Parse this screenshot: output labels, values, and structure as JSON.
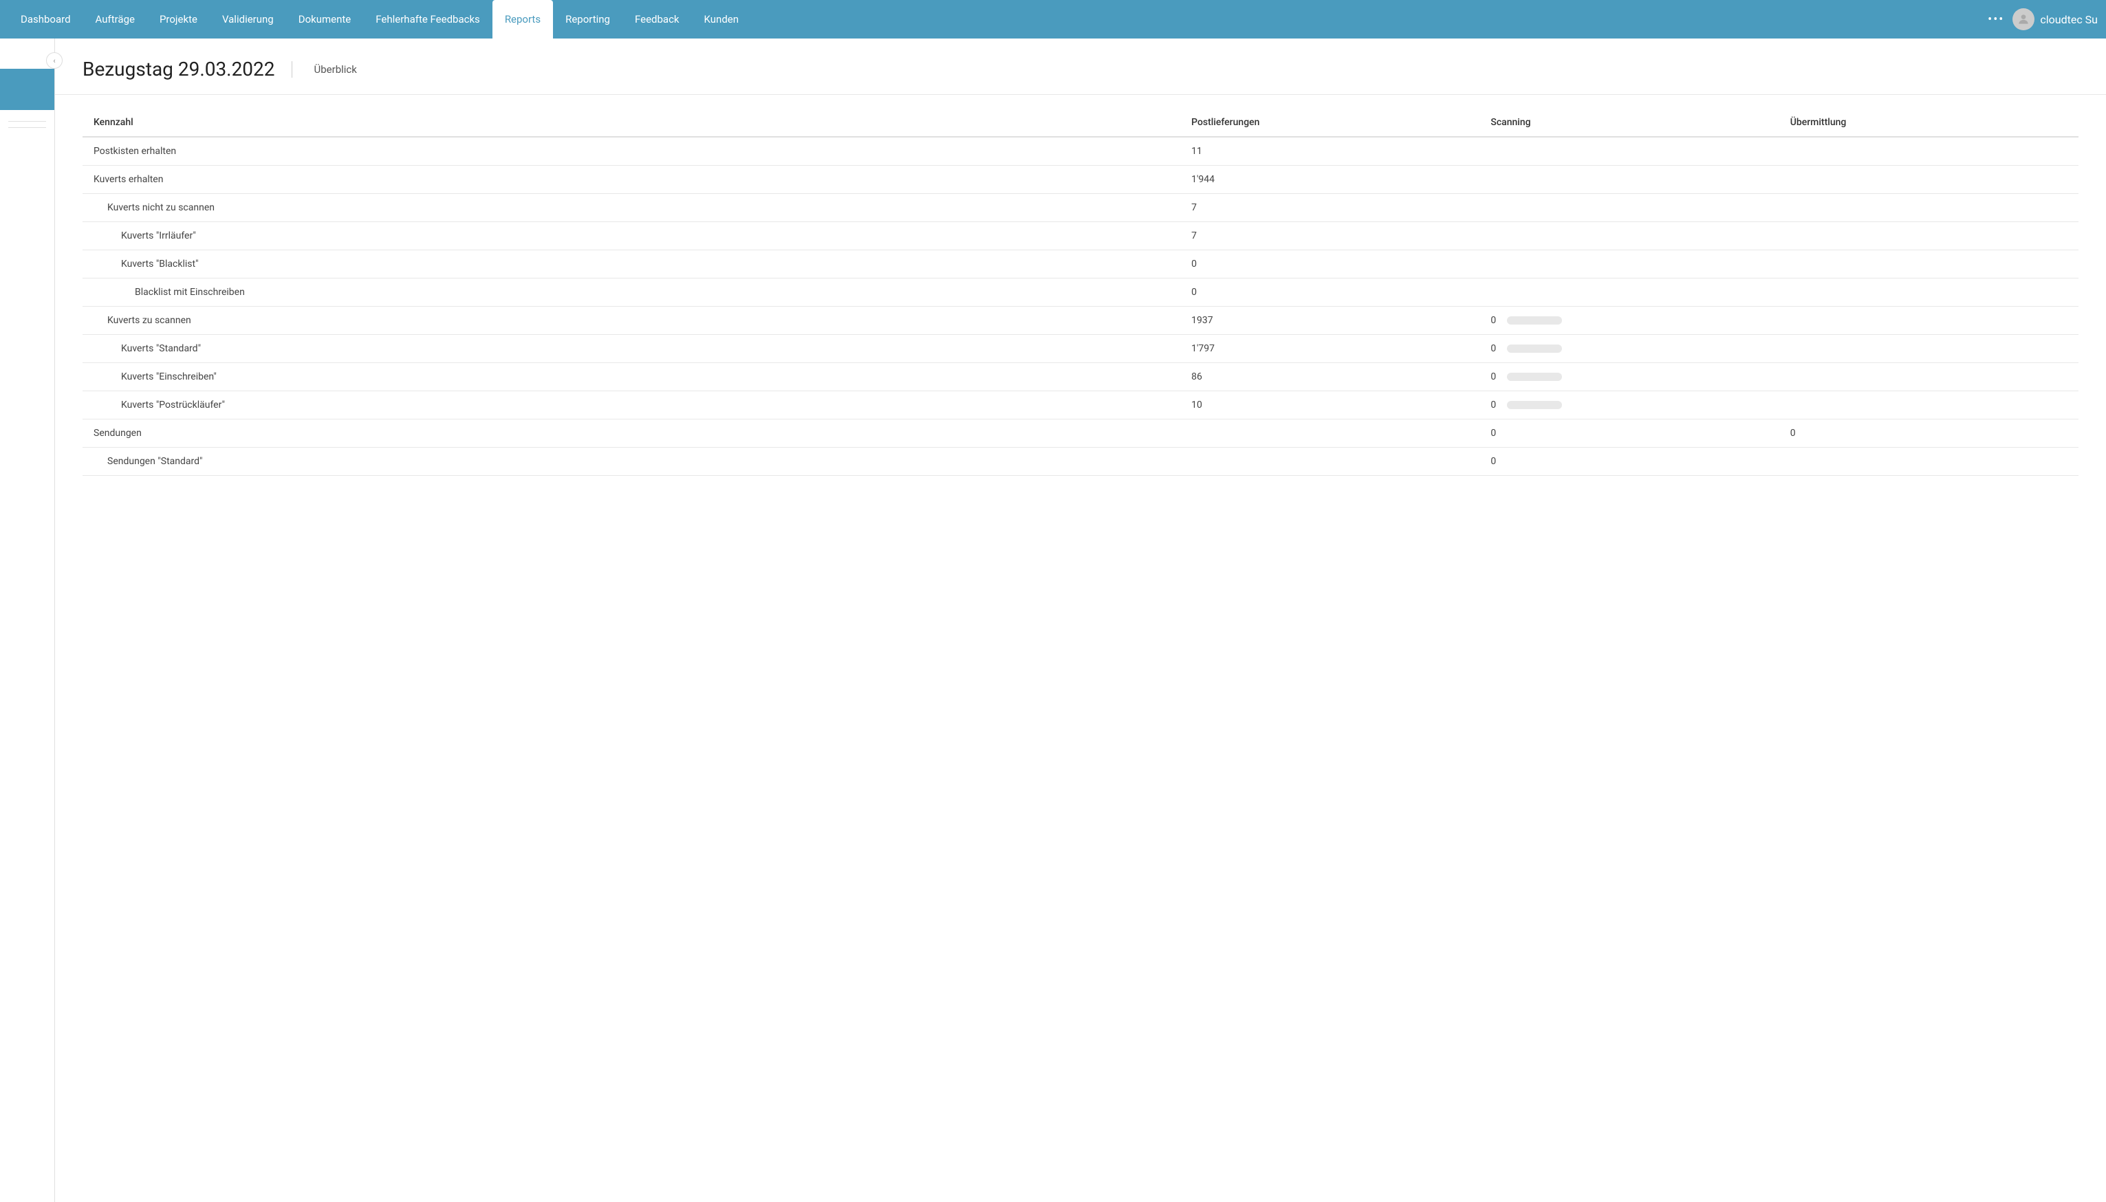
{
  "navbar": {
    "items": [
      {
        "id": "dashboard",
        "label": "Dashboard",
        "active": false
      },
      {
        "id": "auftraege",
        "label": "Aufträge",
        "active": false
      },
      {
        "id": "projekte",
        "label": "Projekte",
        "active": false
      },
      {
        "id": "validierung",
        "label": "Validierung",
        "active": false
      },
      {
        "id": "dokumente",
        "label": "Dokumente",
        "active": false
      },
      {
        "id": "fehlerhafte-feedbacks",
        "label": "Fehlerhafte Feedbacks",
        "active": false
      },
      {
        "id": "reports",
        "label": "Reports",
        "active": true
      },
      {
        "id": "reporting",
        "label": "Reporting",
        "active": false
      },
      {
        "id": "feedback",
        "label": "Feedback",
        "active": false
      },
      {
        "id": "kunden",
        "label": "Kunden",
        "active": false
      }
    ],
    "more_label": "•••",
    "user_label": "cloudtec Su"
  },
  "page": {
    "title": "Bezugstag 29.03.2022",
    "tab_label": "Überblick"
  },
  "table": {
    "headers": {
      "kennzahl": "Kennzahl",
      "postlieferungen": "Postlieferungen",
      "scanning": "Scanning",
      "uebermittlung": "Übermittlung"
    },
    "rows": [
      {
        "id": "postkisten",
        "label": "Postkisten erhalten",
        "indent": 0,
        "postlieferungen": "11",
        "scanning": "",
        "scanning_progress": -1,
        "uebermittlung": ""
      },
      {
        "id": "kuverts-erhalten",
        "label": "Kuverts erhalten",
        "indent": 0,
        "postlieferungen": "1'944",
        "scanning": "",
        "scanning_progress": -1,
        "uebermittlung": ""
      },
      {
        "id": "kuverts-nicht-scannen",
        "label": "Kuverts nicht zu scannen",
        "indent": 1,
        "postlieferungen": "7",
        "scanning": "",
        "scanning_progress": -1,
        "uebermittlung": ""
      },
      {
        "id": "kuverts-irrlaeufer",
        "label": "Kuverts \"Irrläufer\"",
        "indent": 2,
        "postlieferungen": "7",
        "scanning": "",
        "scanning_progress": -1,
        "uebermittlung": ""
      },
      {
        "id": "kuverts-blacklist",
        "label": "Kuverts \"Blacklist\"",
        "indent": 2,
        "postlieferungen": "0",
        "scanning": "",
        "scanning_progress": -1,
        "uebermittlung": ""
      },
      {
        "id": "blacklist-einschreiben",
        "label": "Blacklist mit Einschreiben",
        "indent": 3,
        "postlieferungen": "0",
        "scanning": "",
        "scanning_progress": -1,
        "uebermittlung": ""
      },
      {
        "id": "kuverts-zu-scannen",
        "label": "Kuverts zu scannen",
        "indent": 1,
        "postlieferungen": "1937",
        "scanning": "0",
        "scanning_progress": 0,
        "uebermittlung": ""
      },
      {
        "id": "kuverts-standard",
        "label": "Kuverts \"Standard\"",
        "indent": 2,
        "postlieferungen": "1'797",
        "scanning": "0",
        "scanning_progress": 0,
        "uebermittlung": ""
      },
      {
        "id": "kuverts-einschreiben",
        "label": "Kuverts \"Einschreiben\"",
        "indent": 2,
        "postlieferungen": "86",
        "scanning": "0",
        "scanning_progress": 0,
        "uebermittlung": ""
      },
      {
        "id": "kuverts-postruecklaeufer",
        "label": "Kuverts \"Postrückläufer\"",
        "indent": 2,
        "postlieferungen": "10",
        "scanning": "0",
        "scanning_progress": 0,
        "uebermittlung": ""
      },
      {
        "id": "sendungen",
        "label": "Sendungen",
        "indent": 0,
        "postlieferungen": "",
        "scanning": "0",
        "scanning_progress": -1,
        "uebermittlung": "0"
      },
      {
        "id": "sendungen-standard",
        "label": "Sendungen \"Standard\"",
        "indent": 1,
        "postlieferungen": "",
        "scanning": "0",
        "scanning_progress": -1,
        "uebermittlung": ""
      }
    ]
  }
}
